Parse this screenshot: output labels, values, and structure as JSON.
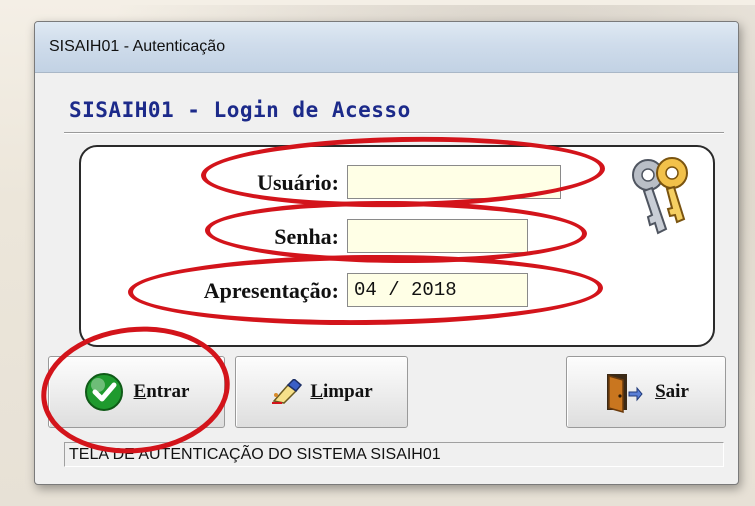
{
  "window": {
    "title": "SISAIH01 - Autenticação"
  },
  "login": {
    "heading": "SISAIH01 - Login de Acesso",
    "fields": [
      {
        "label": "Usuário:",
        "value": ""
      },
      {
        "label": "Senha:",
        "value": ""
      },
      {
        "label": "Apresentação:",
        "value": "04 / 2018"
      }
    ]
  },
  "buttons": {
    "entrar": {
      "accesskey": "E",
      "rest": "ntrar"
    },
    "limpar": {
      "accesskey": "L",
      "rest": "impar"
    },
    "sair": {
      "accesskey": "S",
      "rest": "air"
    }
  },
  "status": {
    "text": "TELA DE AUTENTICAÇÃO DO SISTEMA SISAIH01"
  },
  "icons": {
    "keys": "keys-icon",
    "entrar": "check-icon",
    "limpar": "eraser-icon",
    "sair": "exit-door-icon"
  },
  "colors": {
    "heading": "#1c2a8a",
    "input_bg": "#ffffe6",
    "annotation": "#d3141b",
    "check": "#1f9a2e"
  }
}
